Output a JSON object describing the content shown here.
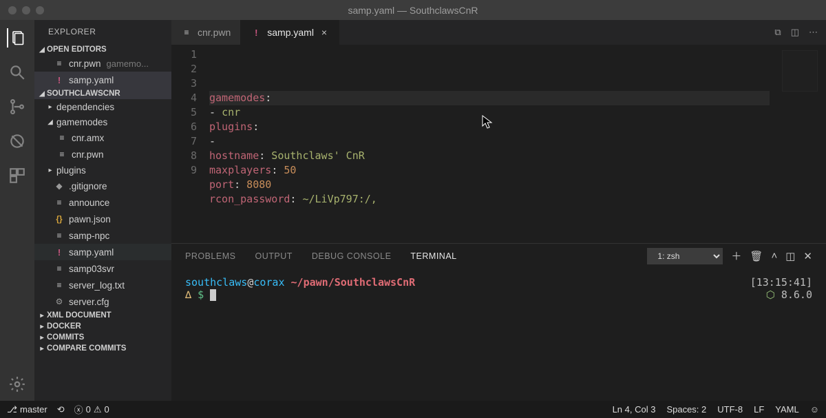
{
  "window": {
    "title": "samp.yaml — SouthclawsCnR"
  },
  "sidebar": {
    "title": "EXPLORER",
    "sections": {
      "open_editors": "OPEN EDITORS",
      "project": "SOUTHCLAWSCNR",
      "xml": "XML DOCUMENT",
      "docker": "DOCKER",
      "commits": "COMMITS",
      "compare": "COMPARE COMMITS"
    },
    "open_items": [
      {
        "name": "cnr.pwn",
        "hint": "gamemo..."
      },
      {
        "name": "samp.yaml",
        "hint": ""
      }
    ],
    "tree": {
      "dependencies": "dependencies",
      "gamemodes": "gamemodes",
      "gm_children": [
        "cnr.amx",
        "cnr.pwn"
      ],
      "plugins": "plugins",
      "files": [
        ".gitignore",
        "announce",
        "pawn.json",
        "samp-npc",
        "samp.yaml",
        "samp03svr",
        "server_log.txt",
        "server.cfg"
      ]
    }
  },
  "tabs": [
    {
      "icon": "≡",
      "label": "cnr.pwn",
      "active": false
    },
    {
      "icon": "!",
      "label": "samp.yaml",
      "active": true
    }
  ],
  "editor": {
    "lines": [
      "1",
      "2",
      "3",
      "4",
      "5",
      "6",
      "7",
      "8",
      "9"
    ],
    "code": [
      {
        "type": "kv",
        "k": "gamemodes",
        "v": ""
      },
      {
        "type": "li",
        "v": "cnr"
      },
      {
        "type": "kv",
        "k": "plugins",
        "v": ""
      },
      {
        "type": "li",
        "v": ""
      },
      {
        "type": "kv",
        "k": "hostname",
        "v": "Southclaws' CnR"
      },
      {
        "type": "kv",
        "k": "maxplayers",
        "n": "50"
      },
      {
        "type": "kv",
        "k": "port",
        "n": "8080"
      },
      {
        "type": "kv",
        "k": "rcon_password",
        "v": "~/LiVp797:/,"
      },
      {
        "type": "blank"
      }
    ],
    "highlight_line_index": 3
  },
  "panel": {
    "tabs": [
      "PROBLEMS",
      "OUTPUT",
      "DEBUG CONSOLE",
      "TERMINAL"
    ],
    "active": "TERMINAL",
    "shell_label": "1: zsh"
  },
  "terminal": {
    "user": "southclaws",
    "host": "corax",
    "path": "~/pawn/SouthclawsCnR",
    "time": "[13:15:41]",
    "delta": "∆",
    "prompt": "$",
    "node": "8.6.0",
    "node_icon": "⬡"
  },
  "status": {
    "branch": "master",
    "sync_icon": "⟲",
    "errors": "0",
    "warnings": "0",
    "cursor": "Ln 4, Col 3",
    "spaces": "Spaces: 2",
    "encoding": "UTF-8",
    "eol": "LF",
    "lang": "YAML",
    "smile": "☺"
  }
}
